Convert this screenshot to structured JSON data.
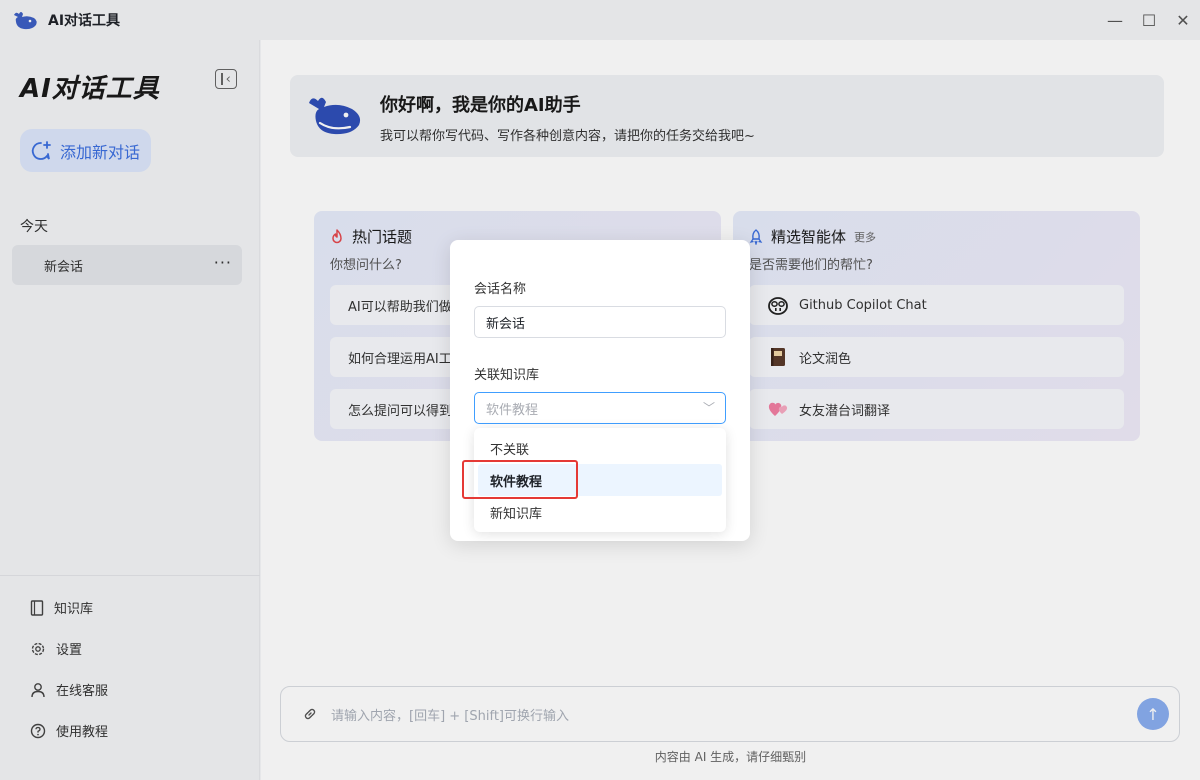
{
  "app": {
    "title": "AI对话工具",
    "brand": "AI对话工具"
  },
  "window_controls": {
    "minimize": "—",
    "maximize": "☐",
    "close": "✕"
  },
  "sidebar": {
    "new_chat_label": "添加新对话",
    "section_today": "今天",
    "conversations": [
      {
        "name": "新会话",
        "more": "···"
      }
    ],
    "menu": [
      {
        "label": "知识库",
        "icon": "book-icon"
      },
      {
        "label": "设置",
        "icon": "gear-icon"
      },
      {
        "label": "在线客服",
        "icon": "user-icon"
      },
      {
        "label": "使用教程",
        "icon": "help-icon"
      }
    ]
  },
  "hero": {
    "title": "你好啊，我是你的AI助手",
    "subtitle": "我可以帮你写代码、写作各种创意内容，请把你的任务交给我吧~"
  },
  "hot_topics": {
    "title": "热门话题",
    "subtitle": "你想问什么?",
    "items": [
      "AI可以帮助我们做什么",
      "如何合理运用AI工具",
      "怎么提问可以得到更好的回答"
    ]
  },
  "agents": {
    "title": "精选智能体",
    "more": "更多",
    "subtitle": "是否需要他们的帮忙?",
    "items": [
      {
        "label": "Github Copilot Chat",
        "icon": "copilot-icon"
      },
      {
        "label": "论文润色",
        "icon": "notebook-icon"
      },
      {
        "label": "女友潜台词翻译",
        "icon": "hearts-icon"
      }
    ]
  },
  "input": {
    "placeholder": "请输入内容，[回车] + [Shift]可换行输入",
    "send": "↑"
  },
  "footer_note": "内容由 AI 生成，请仔细甄别",
  "modal": {
    "name_label": "会话名称",
    "name_value": "新会话",
    "kb_label": "关联知识库",
    "kb_selected": "软件教程",
    "options": [
      "不关联",
      "软件教程",
      "新知识库"
    ],
    "selected_index": 1
  },
  "colors": {
    "accent": "#3c6fe0",
    "select_border": "#409eff",
    "highlight": "#e53935"
  }
}
